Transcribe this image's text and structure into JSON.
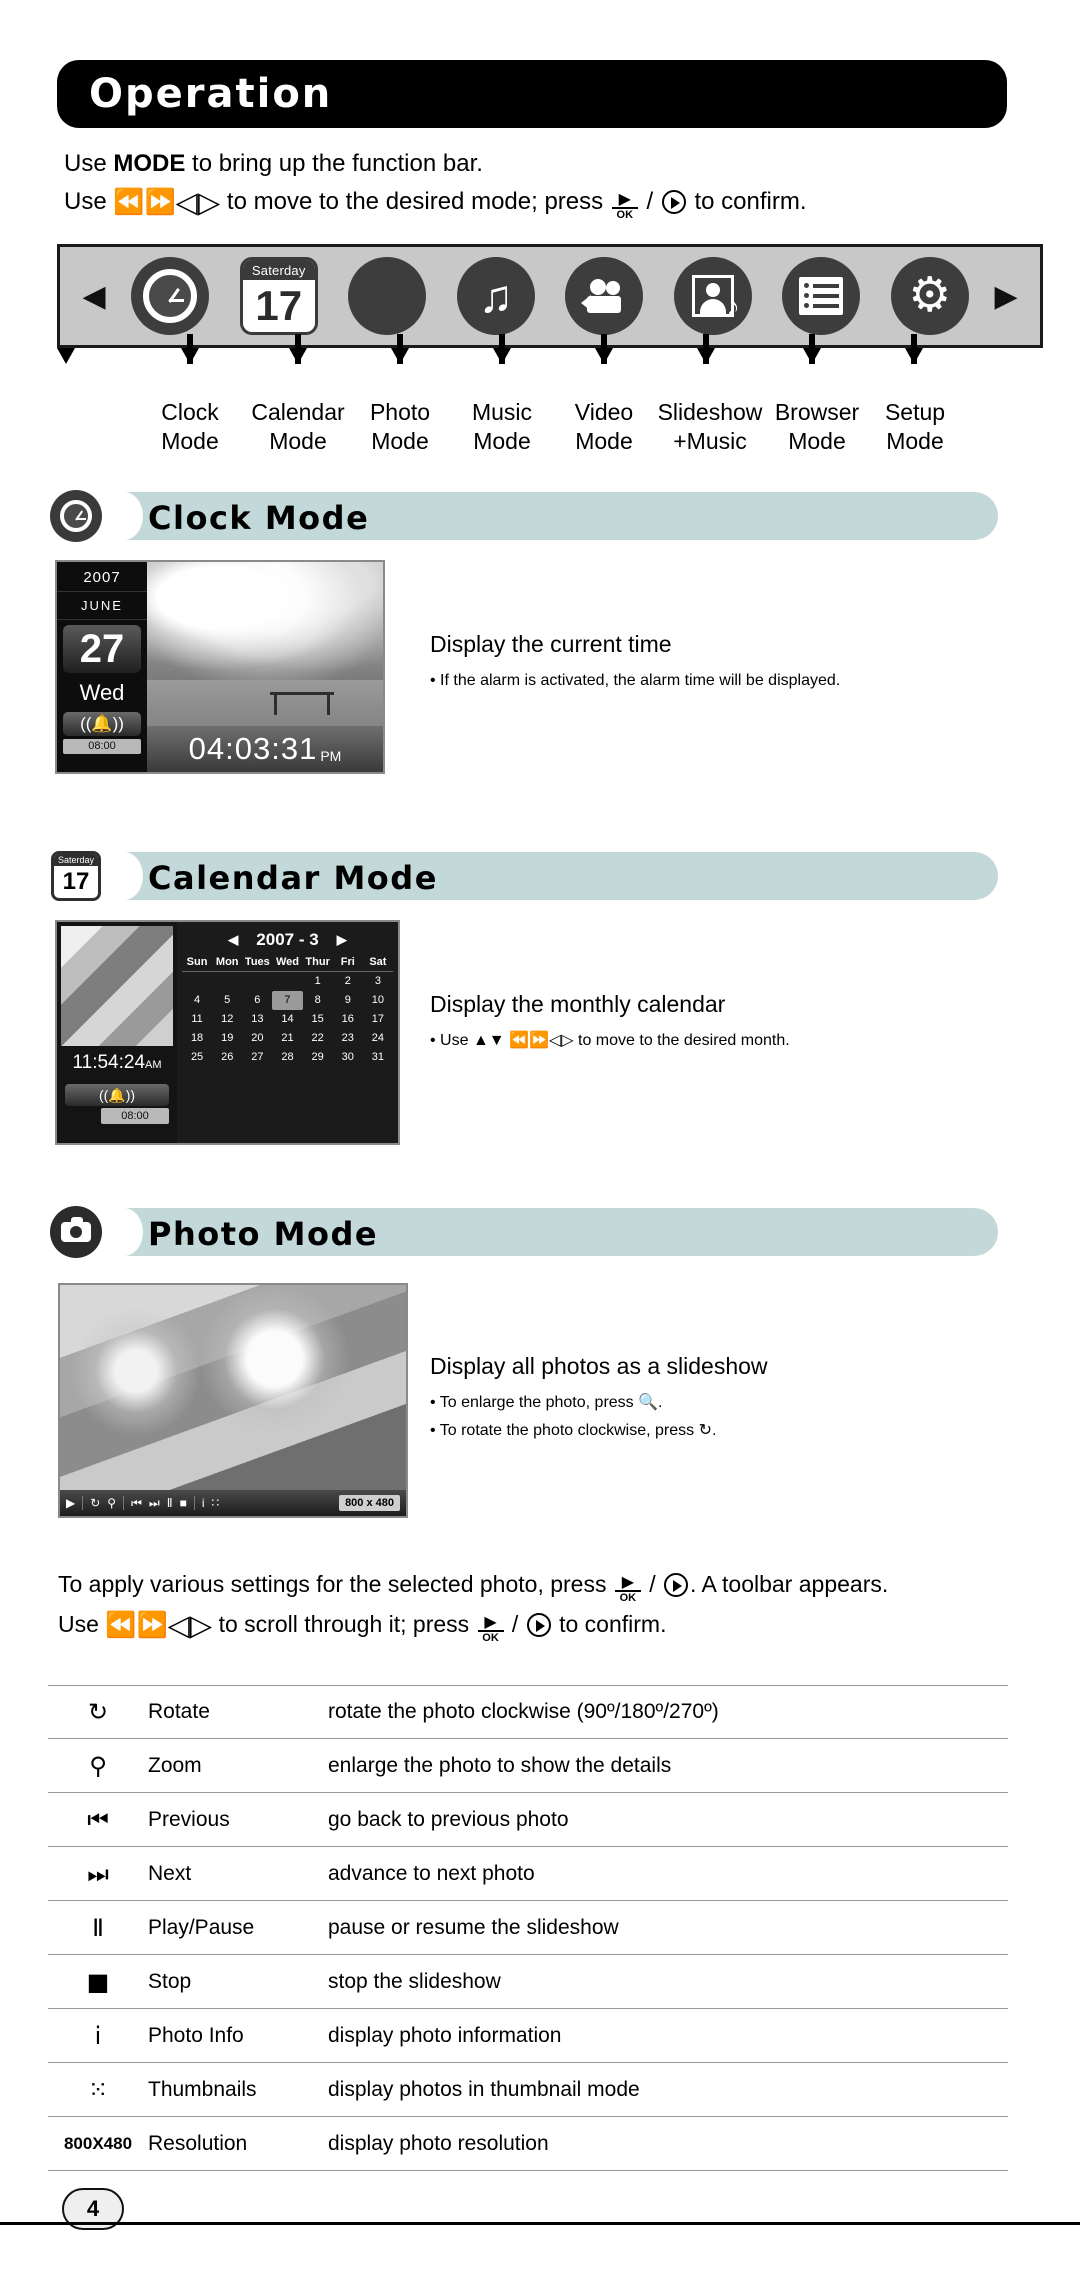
{
  "header": {
    "title": "Operation"
  },
  "intro": {
    "line1_pre": "Use ",
    "line1_bold": "MODE",
    "line1_post": " to bring up the function bar.",
    "line2_pre": "Use ",
    "line2_mid": " to move to the desired mode; press ",
    "line2_post": " to confirm."
  },
  "function_bar": {
    "prev_arrow": "◀",
    "next_arrow": "▶",
    "calendar_icon": {
      "weekday": "Saterday",
      "day": "17"
    },
    "music_note": "♫",
    "gear": "⚙",
    "modes": [
      {
        "label_line1": "Clock",
        "label_line2": "Mode",
        "icon": "clock-icon"
      },
      {
        "label_line1": "Calendar",
        "label_line2": "Mode",
        "icon": "calendar-icon"
      },
      {
        "label_line1": "Photo",
        "label_line2": "Mode",
        "icon": "photo-icon"
      },
      {
        "label_line1": "Music",
        "label_line2": "Mode",
        "icon": "music-icon"
      },
      {
        "label_line1": "Video",
        "label_line2": "Mode",
        "icon": "video-icon"
      },
      {
        "label_line1": "Slideshow",
        "label_line2": "+Music",
        "icon": "slideshow-music-icon"
      },
      {
        "label_line1": "Browser",
        "label_line2": "Mode",
        "icon": "browser-list-icon"
      },
      {
        "label_line1": "Setup",
        "label_line2": "Mode",
        "icon": "setup-gear-icon"
      }
    ]
  },
  "sections": {
    "clock": {
      "title": "Clock Mode",
      "desc_title": "Display the current time",
      "desc_bullet": "• If the alarm is activated, the alarm time will be displayed.",
      "screen": {
        "year": "2007",
        "month": "JUNE",
        "day": "27",
        "weekday": "Wed",
        "alarm_icon": "((▲))",
        "alarm_time": "08:00",
        "time": "04:03:31",
        "ampm": "PM"
      }
    },
    "calendar": {
      "title": "Calendar Mode",
      "icon_weekday": "Saterday",
      "icon_day": "17",
      "desc_title": "Display the monthly calendar",
      "desc_bullet_pre": "• Use ",
      "desc_bullet_post": " to move to the desired month.",
      "screen": {
        "clock": "11:54:24",
        "ampm": "AM",
        "alarm_time": "08:00",
        "month_label": "2007 - 3",
        "prev": "◀",
        "next": "▶",
        "dow": [
          "Sun",
          "Mon",
          "Tues",
          "Wed",
          "Thur",
          "Fri",
          "Sat"
        ],
        "weeks": [
          [
            "",
            "",
            "",
            "",
            "1",
            "2",
            "3"
          ],
          [
            "4",
            "5",
            "6",
            "7",
            "8",
            "9",
            "10"
          ],
          [
            "11",
            "12",
            "13",
            "14",
            "15",
            "16",
            "17"
          ],
          [
            "18",
            "19",
            "20",
            "21",
            "22",
            "23",
            "24"
          ],
          [
            "25",
            "26",
            "27",
            "28",
            "29",
            "30",
            "31"
          ]
        ],
        "selected_day": "7"
      }
    },
    "photo": {
      "title": "Photo Mode",
      "desc_title": "Display all photos as a slideshow",
      "desc_bullet1_pre": "• To enlarge the photo, press ",
      "desc_bullet1_post": ".",
      "desc_bullet2_pre": "• To rotate the photo clockwise, press ",
      "desc_bullet2_post": ".",
      "toolbar": {
        "play": "▶",
        "rotate": "↻",
        "zoom": "⚲",
        "previous": "⏮",
        "next": "⏭",
        "pause": "Ⅱ",
        "stop": "■",
        "info": "i",
        "thumbnails": "∷",
        "resolution": "800 x 480"
      }
    }
  },
  "paragraph": {
    "line1_pre": "To apply various settings for the selected photo, press ",
    "line1_post": ". A toolbar appears.",
    "line2_pre": "Use ",
    "line2_post": " to scroll through it; press ",
    "line2_end": " to confirm."
  },
  "table": {
    "rows": [
      {
        "icon": "↻",
        "icon_name": "rotate-icon",
        "name": "Rotate",
        "desc": "rotate the photo clockwise (90º/180º/270º)"
      },
      {
        "icon": "⚲",
        "icon_name": "zoom-icon",
        "name": "Zoom",
        "desc": "enlarge the photo to show the details"
      },
      {
        "icon": "⏮",
        "icon_name": "previous-icon",
        "name": "Previous",
        "desc": "go back to previous photo"
      },
      {
        "icon": "⏭",
        "icon_name": "next-icon",
        "name": "Next",
        "desc": "advance to next photo"
      },
      {
        "icon": "Ⅱ",
        "icon_name": "play-pause-icon",
        "name": "Play/Pause",
        "desc": "pause or resume the slideshow"
      },
      {
        "icon": "■",
        "icon_name": "stop-icon",
        "name": "Stop",
        "desc": "stop the slideshow"
      },
      {
        "icon": "i",
        "icon_name": "photo-info-icon",
        "name": "Photo Info",
        "desc": "display photo information"
      },
      {
        "icon": "⁙",
        "icon_name": "thumbnails-icon",
        "name": "Thumbnails",
        "desc": "display photos in thumbnail mode"
      },
      {
        "icon": "800X480",
        "icon_name": "resolution-icon",
        "name": "Resolution",
        "desc": "display photo resolution"
      }
    ]
  },
  "footer": {
    "page_number": "4"
  }
}
